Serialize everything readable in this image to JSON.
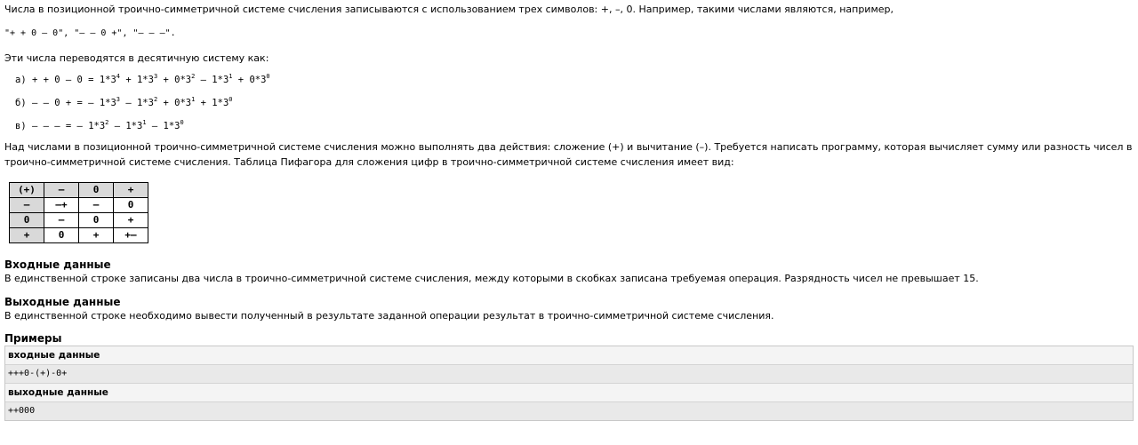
{
  "intro": {
    "line1": "Числа в позиционной троично-симметричной системе счисления записываются с использованием трех символов: +, –, 0. Например, такими числами являются, например,",
    "examples": "\"+ + 0 – 0\", \"– – 0 +\", \"– – –\"."
  },
  "conversion": {
    "heading": "Эти числа переводятся в десятичную систему как:",
    "rows": [
      {
        "prefix": "а) + + 0 – 0 = ",
        "terms": [
          [
            "1*3",
            "4",
            " + "
          ],
          [
            "1*3",
            "3",
            " + "
          ],
          [
            "0*3",
            "2",
            " – "
          ],
          [
            "1*3",
            "1",
            " + "
          ],
          [
            "0*3",
            "0",
            ""
          ]
        ]
      },
      {
        "prefix": "б) – – 0 + = – ",
        "terms": [
          [
            "1*3",
            "3",
            " – "
          ],
          [
            "1*3",
            "2",
            " + "
          ],
          [
            "0*3",
            "1",
            " + "
          ],
          [
            "1*3",
            "0",
            ""
          ]
        ]
      },
      {
        "prefix": "в) – – – = – ",
        "terms": [
          [
            "1*3",
            "2",
            " – "
          ],
          [
            "1*3",
            "1",
            " – "
          ],
          [
            "1*3",
            "0",
            ""
          ]
        ]
      }
    ]
  },
  "ops_text": "Над числами в позиционной троично-симметричной системе счисления можно выполнять два действия: сложение (+) и вычитание (–). Требуется написать программу, которая вычисляет сумму или разность чисел в троично-симметричной системе счисления. Таблица Пифагора для сложения цифр в троично-симметричной системе счисления имеет вид:",
  "table": {
    "header": [
      "(+)",
      "–",
      "0",
      "+"
    ],
    "rows": [
      [
        "–",
        "–+",
        "–",
        "0"
      ],
      [
        "0",
        "–",
        "0",
        "+"
      ],
      [
        "+",
        "0",
        "+",
        "+–"
      ]
    ]
  },
  "input_section": {
    "title": "Входные данные",
    "text": "В единственной строке записаны два числа в троично-симметричной системе счисления, между которыми в скобках записана требуемая операция. Разрядность чисел не превышает 15."
  },
  "output_section": {
    "title": "Выходные данные",
    "text": "В единственной строке необходимо вывести полученный в результате заданной операции результат в троично-симметричной системе счисления."
  },
  "examples": {
    "title": "Примеры",
    "input_label": "входные данные",
    "input_value": "+++0-(+)-0+",
    "output_label": "выходные данные",
    "output_value": "++000"
  }
}
